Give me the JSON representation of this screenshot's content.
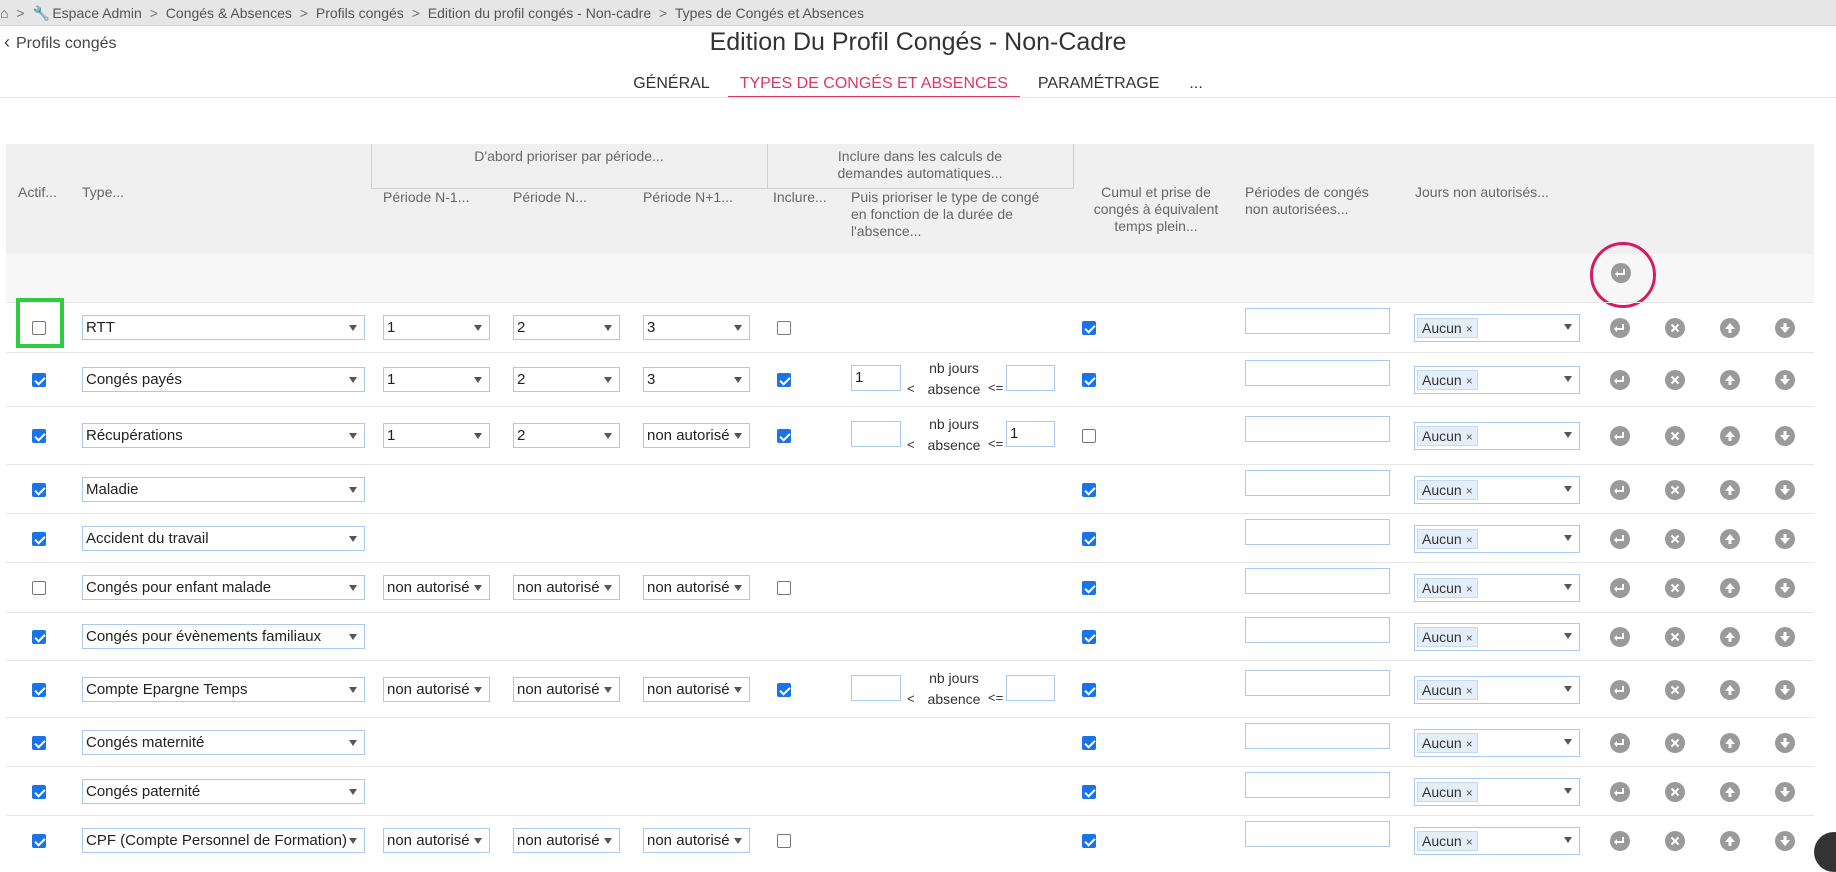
{
  "breadcrumb": {
    "home": "⌂",
    "items": [
      "Espace Admin",
      "Congés & Absences",
      "Profils congés",
      "Edition du profil congés - Non-cadre",
      "Types de Congés et Absences"
    ],
    "separator": ">"
  },
  "back_link": "Profils congés",
  "page_title": "Edition Du Profil Congés - Non-Cadre",
  "tabs": [
    {
      "label": "GÉNÉRAL"
    },
    {
      "label": "TYPES DE CONGÉS ET ABSENCES"
    },
    {
      "label": "PARAMÉTRAGE"
    },
    {
      "label": "..."
    }
  ],
  "table_header": {
    "actif": "Actif...",
    "type": "Type...",
    "group_prioriser": "D'abord prioriser par période...",
    "periode_n1": "Période N-1...",
    "periode_n": "Période N...",
    "periode_np1": "Période N+1...",
    "group_inclure": "Inclure dans les calculs de demandes automatiques...",
    "inclure": "Inclure...",
    "puis_prioriser": "Puis prioriser le type de congé en fonction de la durée de l'absence...",
    "cumul": "Cumul et prise de congés à équivalent temps plein...",
    "periodes_non_autorisees": "Périodes de congés non autorisées...",
    "jours_non_autorises": "Jours non autorisés..."
  },
  "nb_jours_label_1": "nb jours",
  "nb_jours_label_2": "absence",
  "lt_symbol": "<",
  "le_symbol": "<=",
  "rows": [
    {
      "active": false,
      "type": "RTT",
      "n1": "1",
      "n": "2",
      "np1": "3",
      "include": false,
      "min": null,
      "max": null,
      "cumul": true,
      "jours": "Aucun"
    },
    {
      "active": true,
      "type": "Congés payés",
      "n1": "1",
      "n": "2",
      "np1": "3",
      "include": true,
      "min": "1",
      "max": "",
      "cumul": true,
      "jours": "Aucun"
    },
    {
      "active": true,
      "type": "Récupérations",
      "n1": "1",
      "n": "2",
      "np1": "non autorisé",
      "include": true,
      "min": "",
      "max": "1",
      "cumul": false,
      "jours": "Aucun"
    },
    {
      "active": true,
      "type": "Maladie",
      "n1": null,
      "n": null,
      "np1": null,
      "include": null,
      "min": null,
      "max": null,
      "cumul": true,
      "jours": "Aucun"
    },
    {
      "active": true,
      "type": "Accident du travail",
      "n1": null,
      "n": null,
      "np1": null,
      "include": null,
      "min": null,
      "max": null,
      "cumul": true,
      "jours": "Aucun"
    },
    {
      "active": false,
      "type": "Congés pour enfant malade",
      "n1": "non autorisé",
      "n": "non autorisé",
      "np1": "non autorisé",
      "include": false,
      "min": null,
      "max": null,
      "cumul": true,
      "jours": "Aucun"
    },
    {
      "active": true,
      "type": "Congés pour évènements familiaux",
      "n1": null,
      "n": null,
      "np1": null,
      "include": null,
      "min": null,
      "max": null,
      "cumul": true,
      "jours": "Aucun"
    },
    {
      "active": true,
      "type": "Compte Epargne Temps",
      "n1": "non autorisé",
      "n": "non autorisé",
      "np1": "non autorisé",
      "include": true,
      "min": "",
      "max": "",
      "cumul": true,
      "jours": "Aucun"
    },
    {
      "active": true,
      "type": "Congés maternité",
      "n1": null,
      "n": null,
      "np1": null,
      "include": null,
      "min": null,
      "max": null,
      "cumul": true,
      "jours": "Aucun"
    },
    {
      "active": true,
      "type": "Congés paternité",
      "n1": null,
      "n": null,
      "np1": null,
      "include": null,
      "min": null,
      "max": null,
      "cumul": true,
      "jours": "Aucun"
    },
    {
      "active": true,
      "type": "CPF (Compte Personnel de Formation)",
      "n1": "non autorisé",
      "n": "non autorisé",
      "np1": "non autorisé",
      "include": false,
      "min": null,
      "max": null,
      "cumul": true,
      "jours": "Aucun"
    }
  ],
  "colors": {
    "accent": "#e0355d",
    "highlight": "#2ecc40",
    "checkbox": "#1a73e8",
    "focus_ring": "#d81b60"
  }
}
